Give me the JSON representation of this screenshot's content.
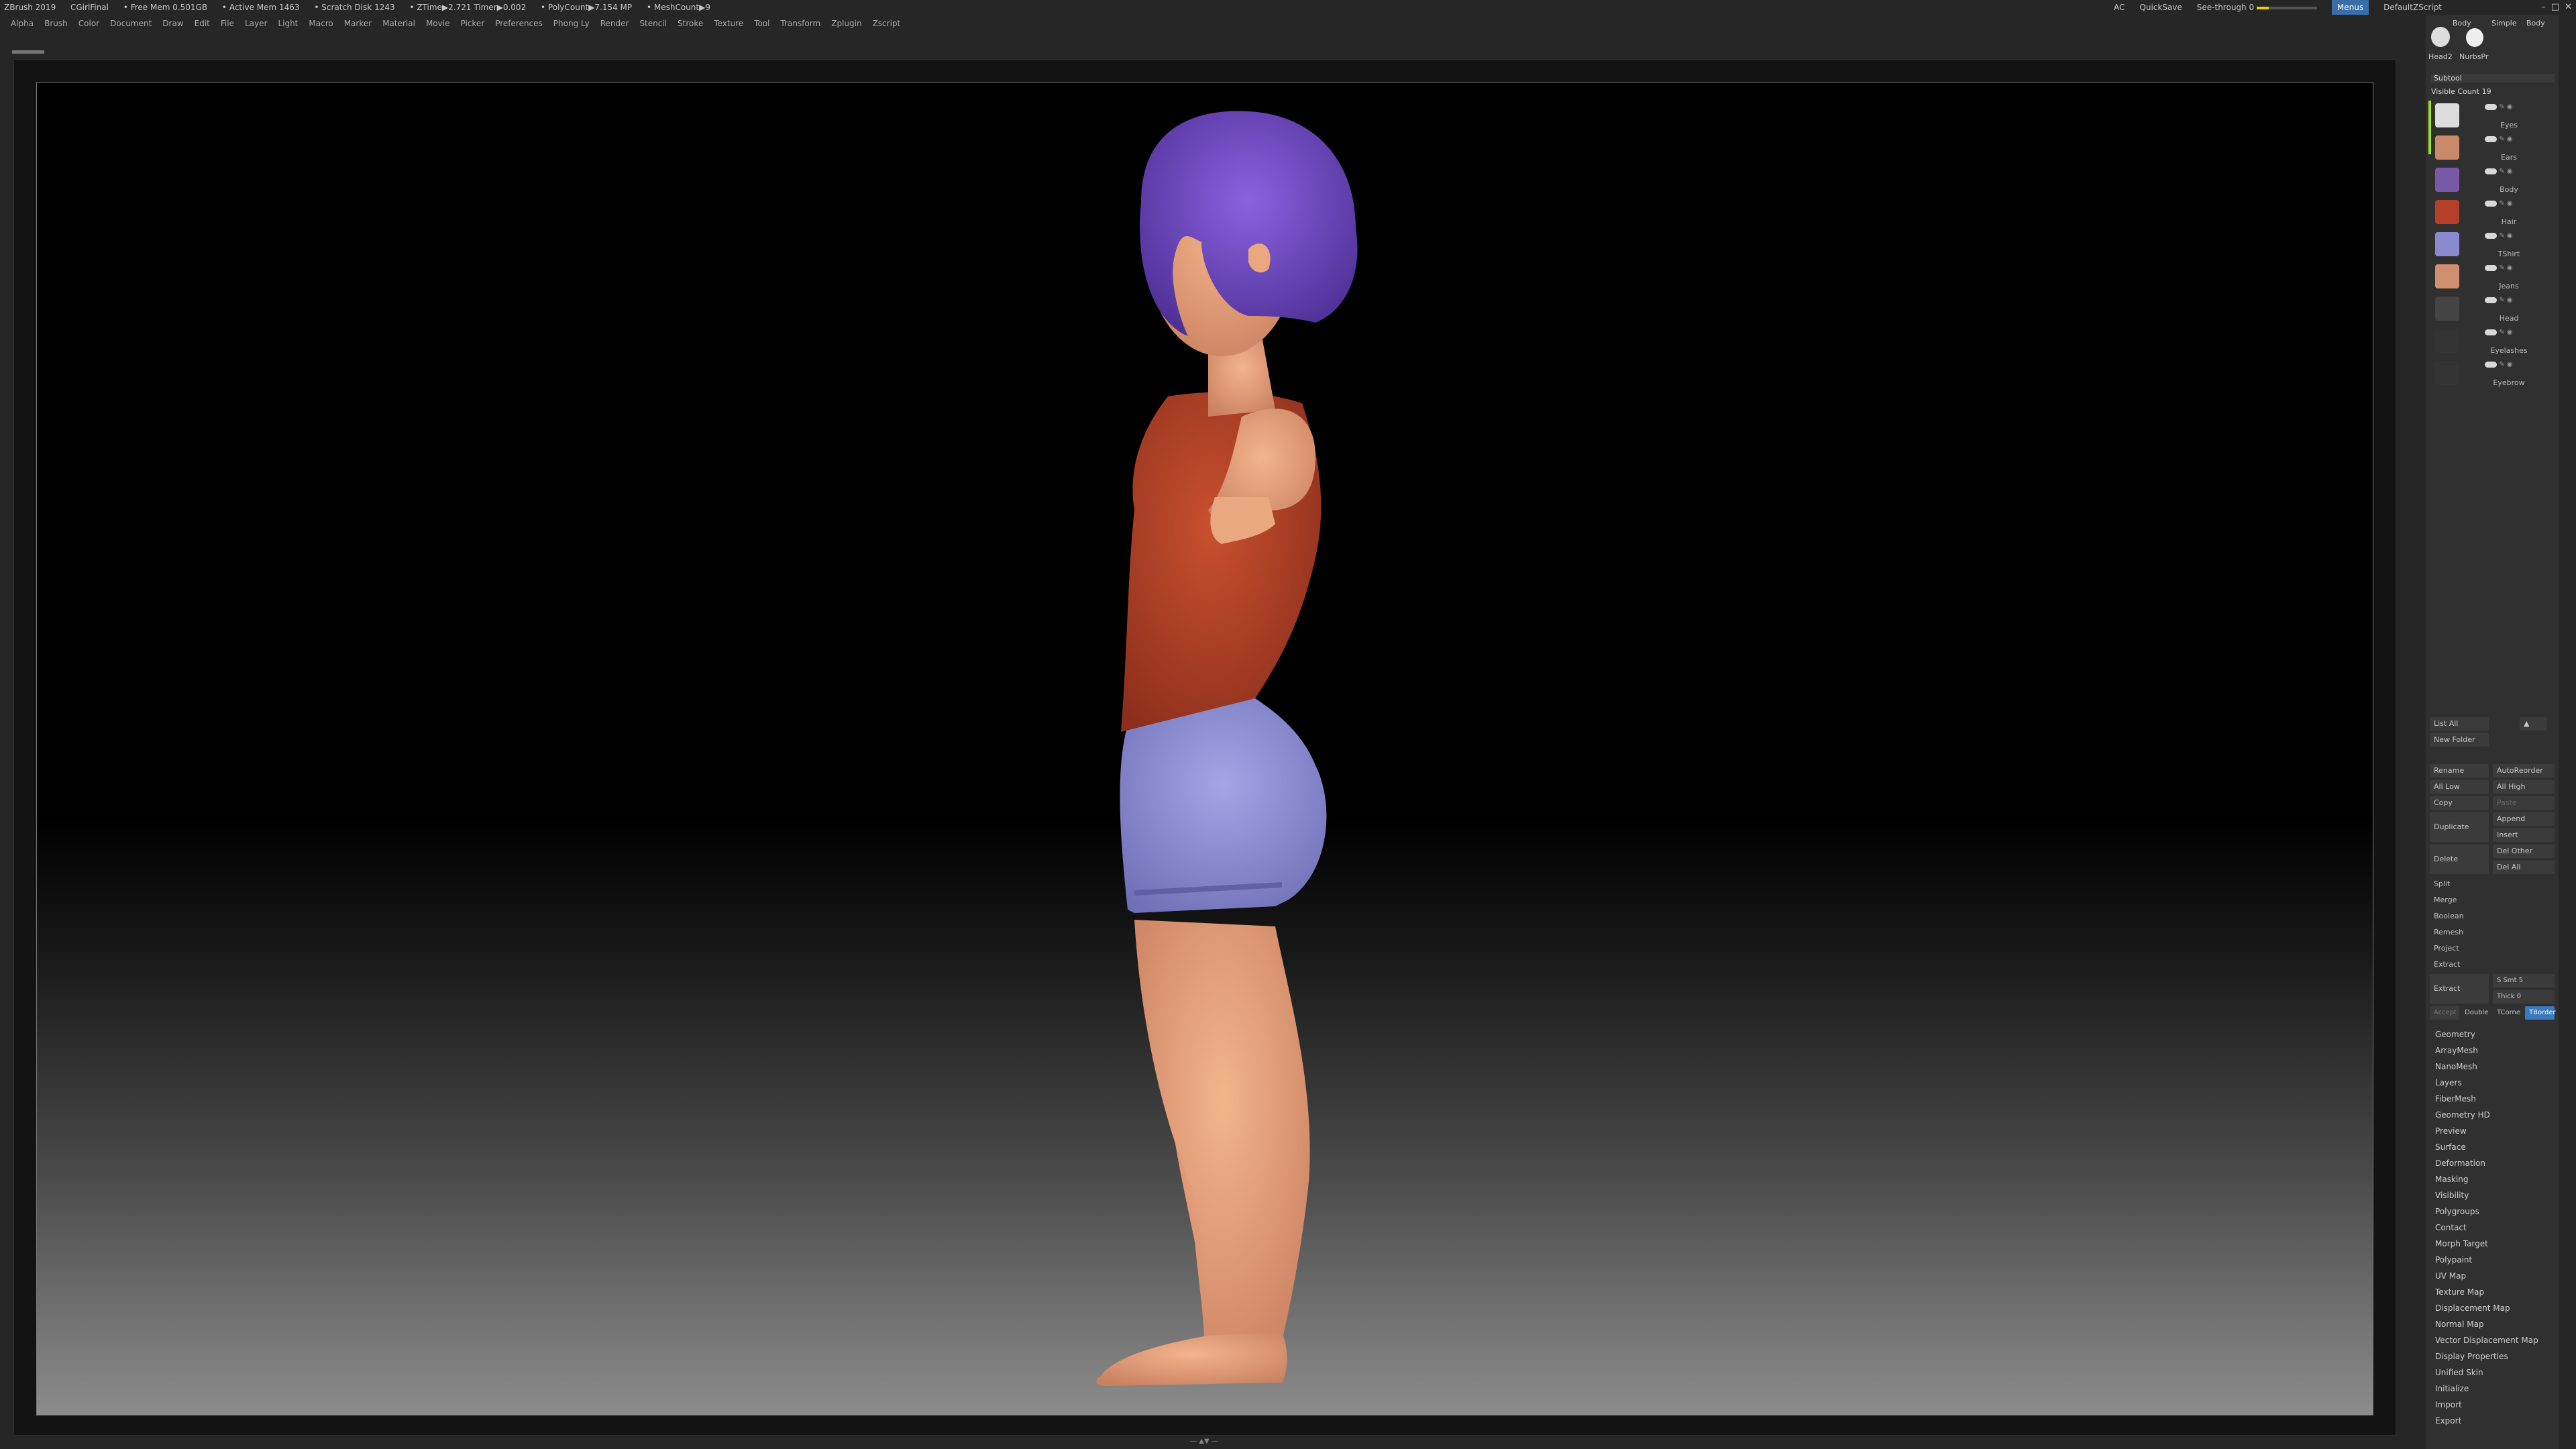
{
  "titlebar": {
    "app": "ZBrush 2019",
    "file": "CGirlFinal",
    "free_mem": "• Free Mem 0.501GB",
    "active_mem": "• Active Mem 1463",
    "scratch": "• Scratch Disk 1243",
    "ztime": "• ZTime▶2.721 Timer▶0.002",
    "polycount": "• PolyCount▶7.154 MP",
    "meshcount": "• MeshCount▶9",
    "ac": "AC",
    "quicksave": "QuickSave",
    "seethrough": "See-through 0",
    "menus": "Menus",
    "script": "DefaultZScript"
  },
  "menubar": [
    "Alpha",
    "Brush",
    "Color",
    "Document",
    "Draw",
    "Edit",
    "File",
    "Layer",
    "Light",
    "Macro",
    "Marker",
    "Material",
    "Movie",
    "Picker",
    "Preferences",
    "Phong Ly",
    "Render",
    "Stencil",
    "Stroke",
    "Texture",
    "Tool",
    "Transform",
    "Zplugin",
    "Zscript"
  ],
  "tools": {
    "item1": "Body",
    "item2": "Simple",
    "item3": "Body",
    "lbl1": "Head2",
    "lbl2": "NurbsPr"
  },
  "subtool": {
    "header": "Subtool",
    "visible_count": "Visible Count 19",
    "items": [
      "Eyes",
      "Ears",
      "Body",
      "Hair",
      "TShirt",
      "Jeans",
      "Head",
      "Eyelashes",
      "Eyebrow"
    ]
  },
  "buttons": {
    "list_all": "List All",
    "new_folder": "New Folder",
    "rename": "Rename",
    "autoreorder": "AutoReorder",
    "all_low": "All Low",
    "all_high": "All High",
    "copy": "Copy",
    "paste": "Paste",
    "duplicate": "Duplicate",
    "append": "Append",
    "insert": "Insert",
    "delete": "Delete",
    "del_other": "Del Other",
    "del_all": "Del All",
    "split": "Split",
    "merge": "Merge",
    "boolean": "Boolean",
    "remesh": "Remesh",
    "project": "Project",
    "extract_label": "Extract",
    "extract_btn": "Extract",
    "s_smt": "S Smt 5",
    "thick": "Thick 0",
    "accept": "Accept",
    "double": "Double",
    "tcorne": "TCorne",
    "tborder": "TBorder"
  },
  "tool_menu": [
    "Geometry",
    "ArrayMesh",
    "NanoMesh",
    "Layers",
    "FiberMesh",
    "Geometry HD",
    "Preview",
    "Surface",
    "Deformation",
    "Masking",
    "Visibility",
    "Polygroups",
    "Contact",
    "Morph Target",
    "Polypaint",
    "UV Map",
    "Texture Map",
    "Displacement Map",
    "Normal Map",
    "Vector Displacement Map",
    "Display Properties",
    "Unified Skin",
    "Initialize",
    "Import",
    "Export"
  ],
  "colors": {
    "hair": "#6b45c0",
    "tshirt": "#b5402a",
    "shorts": "#8a8ad0",
    "skin": "#e8a07a",
    "accent": "#a0e020"
  }
}
